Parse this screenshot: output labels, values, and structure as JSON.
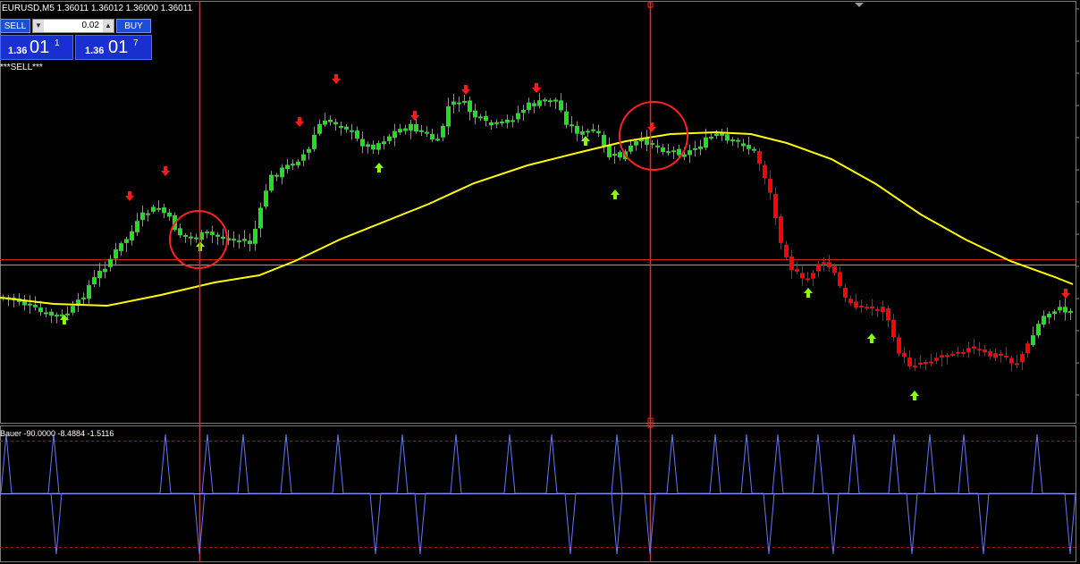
{
  "header": {
    "symbol_line": "EURUSD,M5  1.36011 1.36012 1.36000 1.36011"
  },
  "trade_panel": {
    "sell_label": "SELL",
    "buy_label": "BUY",
    "lot_value": "0.02",
    "lot_down_glyph": "▼",
    "lot_up_glyph": "▲",
    "sell_price": {
      "prefix": "1.36",
      "big": "01",
      "sup": "1"
    },
    "buy_price": {
      "prefix": "1.36",
      "big": "01",
      "sup": "7"
    }
  },
  "signal_text": "***SELL***",
  "indicator": {
    "label": "Bauer -90.0000 -8.4884 -1.5116"
  },
  "colors": {
    "bull": "#22dd22",
    "bear": "#ff0000",
    "ma": "#ffff00",
    "indicator_line": "#6677ff",
    "cursor": "#ff2222",
    "grid": "#2a2a2a",
    "arrow_up": "#88ff00",
    "arrow_down": "#ff1a1a"
  }
}
